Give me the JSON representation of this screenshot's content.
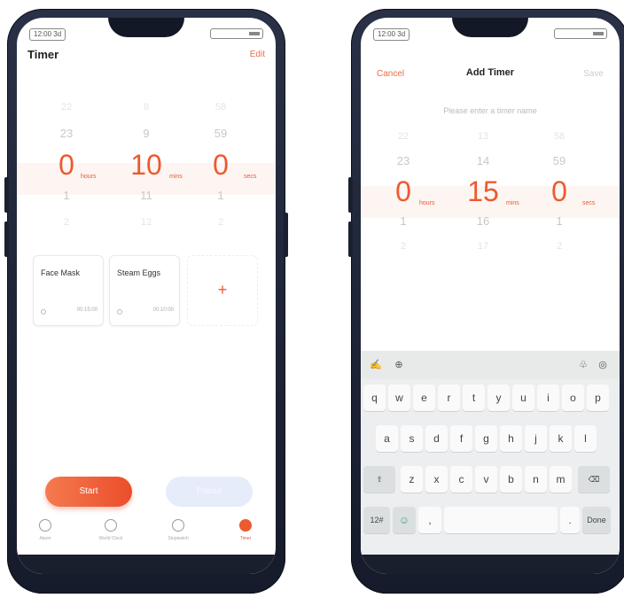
{
  "left": {
    "status_time": "12:00 3d",
    "title": "Timer",
    "edit_label": "Edit",
    "picker": {
      "hours": {
        "far_up": "22",
        "up": "23",
        "selected": "0",
        "down": "1",
        "far_down": "2",
        "unit": "hours"
      },
      "mins": {
        "far_up": "8",
        "up": "9",
        "selected": "10",
        "down": "11",
        "far_down": "12",
        "unit": "mins"
      },
      "secs": {
        "far_up": "58",
        "up": "59",
        "selected": "0",
        "down": "1",
        "far_down": "2",
        "unit": "secs"
      }
    },
    "presets": [
      {
        "name": "Face Mask",
        "time": "00:15:00"
      },
      {
        "name": "Steam Eggs",
        "time": "00:10:00"
      }
    ],
    "add_label": "+",
    "start_label": "Start",
    "pause_label": "Pause",
    "tabs": [
      {
        "label": "Alarm",
        "icon": "alarm-clock-icon"
      },
      {
        "label": "World Clock",
        "icon": "globe-icon"
      },
      {
        "label": "Stopwatch",
        "icon": "stopwatch-icon"
      },
      {
        "label": "Timer",
        "icon": "timer-icon"
      }
    ]
  },
  "right": {
    "status_time": "12:00 3d",
    "cancel_label": "Cancel",
    "title": "Add Timer",
    "save_label": "Save",
    "name_placeholder": "Please enter a timer name",
    "picker": {
      "hours": {
        "far_up": "22",
        "up": "23",
        "selected": "0",
        "down": "1",
        "far_down": "2",
        "unit": "hours"
      },
      "mins": {
        "far_up": "13",
        "up": "14",
        "selected": "15",
        "down": "16",
        "far_down": "17",
        "unit": "mins"
      },
      "secs": {
        "far_up": "58",
        "up": "59",
        "selected": "0",
        "down": "1",
        "far_down": "2",
        "unit": "secs"
      }
    },
    "keyboard": {
      "row1": [
        "q",
        "w",
        "e",
        "r",
        "t",
        "y",
        "u",
        "i",
        "o",
        "p"
      ],
      "row2": [
        "a",
        "s",
        "d",
        "f",
        "g",
        "h",
        "j",
        "k",
        "l"
      ],
      "row3": [
        "z",
        "x",
        "c",
        "v",
        "b",
        "n",
        "m"
      ],
      "numbers_label": "12#",
      "done_label": "Done",
      "comma_label": ",",
      "period_label": "."
    }
  }
}
